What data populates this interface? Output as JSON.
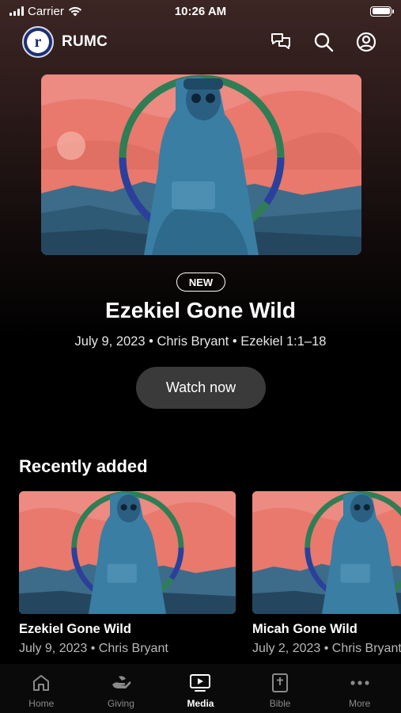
{
  "status_bar": {
    "carrier": "Carrier",
    "time": "10:26 AM",
    "wifi_icon": "wifi-icon",
    "battery_level": 1.0
  },
  "header": {
    "brand_name": "RUMC",
    "logo_letter": "r",
    "actions": [
      "chat-icon",
      "search-icon",
      "account-icon"
    ]
  },
  "hero": {
    "badge": "NEW",
    "title": "Ezekiel Gone Wild",
    "meta": "July 9, 2023 • Chris Bryant • Ezekiel 1:1–18",
    "cta_label": "Watch now"
  },
  "recently_added": {
    "title": "Recently added",
    "items": [
      {
        "title": "Ezekiel Gone Wild",
        "meta": "July 9, 2023 • Chris Bryant"
      },
      {
        "title": "Micah Gone Wild",
        "meta": "July 2, 2023 • Chris Bryant"
      }
    ]
  },
  "tabs": [
    {
      "label": "Home",
      "icon": "home-icon",
      "active": false
    },
    {
      "label": "Giving",
      "icon": "giving-hand-icon",
      "active": false
    },
    {
      "label": "Media",
      "icon": "media-play-icon",
      "active": true
    },
    {
      "label": "Bible",
      "icon": "bible-icon",
      "active": false
    },
    {
      "label": "More",
      "icon": "more-dots-icon",
      "active": false
    }
  ],
  "colors": {
    "art_sky": "#e8796c",
    "art_figure": "#3a7ea3",
    "ring_green": "#2f7d55",
    "ring_blue": "#2b3f9c",
    "ring_orange": "#e0893a",
    "tab_inactive": "#8a8a8a"
  }
}
